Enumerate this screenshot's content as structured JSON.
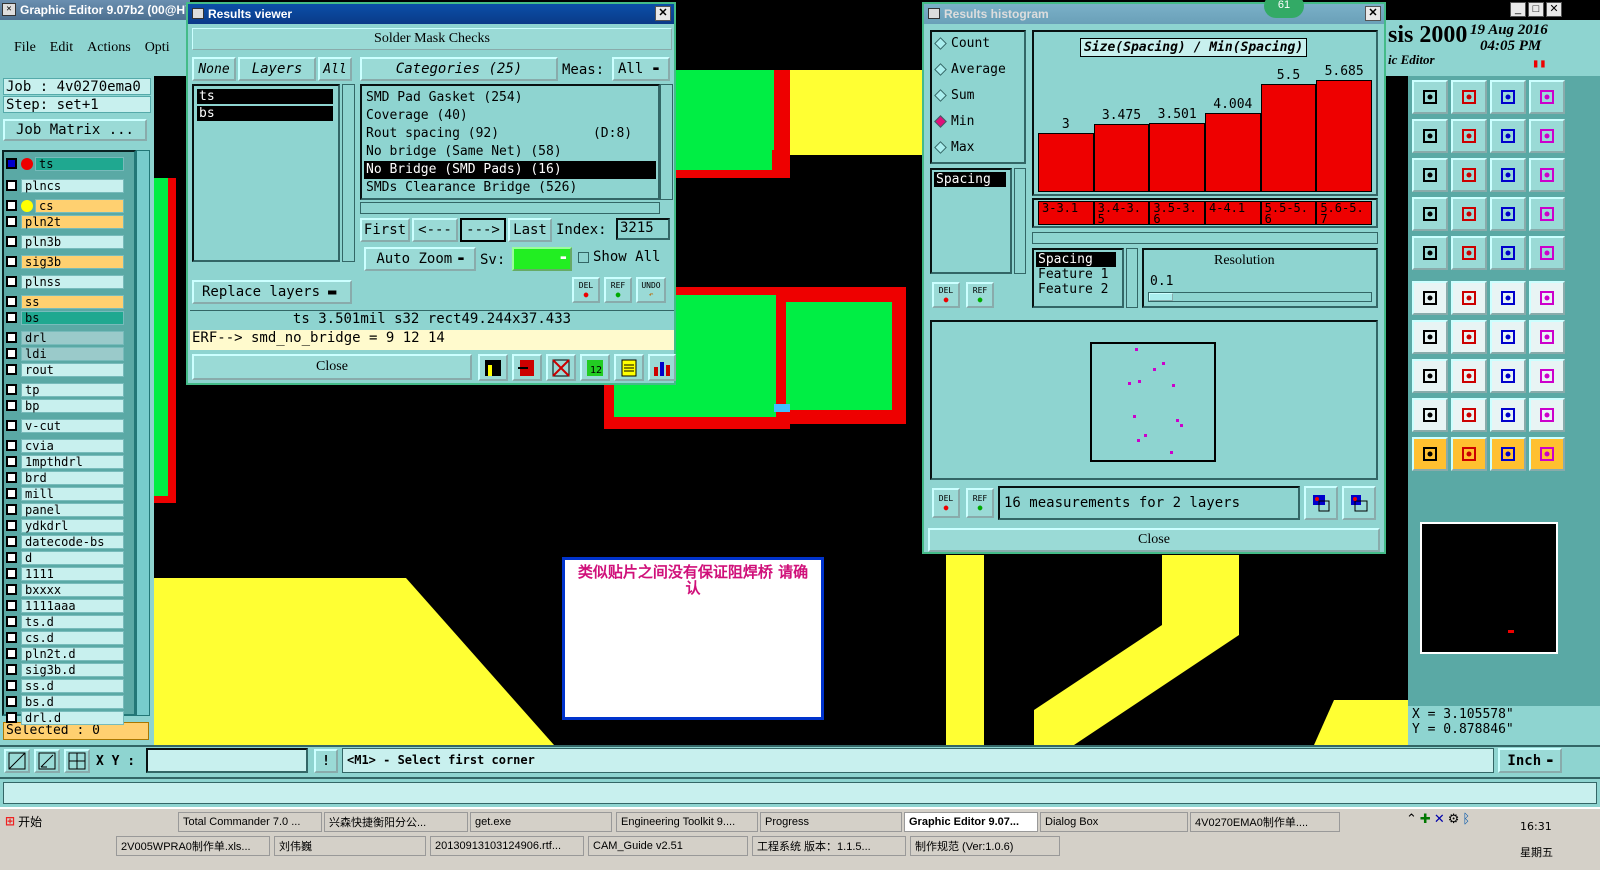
{
  "main_window": {
    "title": "Graphic Editor 9.07b2 (00@HY",
    "menu": [
      "File",
      "Edit",
      "Actions",
      "Opti"
    ],
    "job": "Job : 4v0270ema0",
    "step": "Step: set+1",
    "job_matrix": "Job Matrix ...",
    "selected": "Selected : 0",
    "xy_label": "X Y :",
    "xy_value": "",
    "prompt": "<M1> - Select first corner",
    "units": "Inch",
    "brand": "sis 2000",
    "brand_sub": "ic Editor",
    "date": "19 Aug 2016",
    "time": "04:05 PM",
    "coord_x": "X = 3.105578\"",
    "coord_y": "Y = 0.878846\"",
    "badge": "61"
  },
  "layers": [
    "ts",
    "plncs",
    "cs",
    "pln2t",
    "pln3b",
    "sig3b",
    "plnss",
    "ss",
    "bs",
    "drl",
    "ldi",
    "rout",
    "tp",
    "bp",
    "v-cut",
    "cvia",
    "1mpthdrl",
    "brd",
    "mill",
    "panel",
    "ydkdrl",
    "datecode-bs",
    "d",
    "1111",
    "bxxxx",
    "1111aaa",
    "ts.d",
    "cs.d",
    "pln2t.d",
    "sig3b.d",
    "ss.d",
    "bs.d",
    "drl.d"
  ],
  "results_viewer": {
    "title": "Results viewer",
    "header": "Solder Mask Checks",
    "none": "None",
    "layers": "Layers",
    "all": "All",
    "layer_list": [
      "ts",
      "bs"
    ],
    "categories": "Categories (25)",
    "meas_label": "Meas:",
    "meas_value": "All",
    "category_list": [
      "SMD Pad Gasket (254)",
      "Coverage (40)",
      "Rout spacing (92)            (D:8)",
      "No bridge (Same Net) (58)",
      "No Bridge (SMD Pads) (16)",
      "SMDs Clearance Bridge (526)"
    ],
    "first": "First",
    "prev": "<---",
    "next": "--->",
    "last": "Last",
    "index_label": "Index:",
    "index_value": "3215",
    "auto_zoom": "Auto Zoom",
    "sv_label": "Sv:",
    "show_all": "Show All",
    "replace_layers": "Replace layers",
    "del": "DEL",
    "ref": "REF",
    "undo": "UNDO",
    "status": "ts 3.501mil   s32   rect49.244x37.433",
    "erf": "ERF--> smd_no_bridge = 9 12 14",
    "close": "Close"
  },
  "histogram": {
    "title": "Results histogram",
    "options": [
      "Count",
      "Average",
      "Sum",
      "Min",
      "Max"
    ],
    "selected_option": "Min",
    "chart_title": "Size(Spacing) / Min(Spacing)",
    "list_item": "Spacing",
    "features": [
      "Spacing",
      "Feature 1",
      "Feature 2"
    ],
    "resolution_label": "Resolution",
    "resolution_value": "0.1",
    "measurements": "16 measurements for 2 layers",
    "close": "Close",
    "del": "DEL",
    "ref": "REF"
  },
  "chart_data": {
    "type": "bar",
    "title": "Size(Spacing) / Min(Spacing)",
    "categories": [
      "3-3.1",
      "3.4-3.5",
      "3.5-3.6",
      "4-4.1",
      "5.5-5.6",
      "5.6-5.7"
    ],
    "values": [
      3,
      3.475,
      3.501,
      4.004,
      5.5,
      5.685
    ],
    "value_labels": [
      "3",
      "3.475",
      "3.501",
      "4.004",
      "5.5",
      "5.685"
    ],
    "ylim": [
      0,
      5.9
    ]
  },
  "note": {
    "text": "类似贴片之间没有保证阻焊桥 请确认"
  },
  "taskbar": {
    "start": "开始",
    "row1": [
      "Total Commander 7.0 ...",
      "兴森快捷衡阳分公...",
      "get.exe",
      "Engineering Toolkit 9....",
      "Progress",
      "Graphic Editor 9.07...",
      "Dialog Box",
      "4V0270EMA0制作单...."
    ],
    "row2": [
      "2V005WPRA0制作单.xls...",
      "刘伟巍",
      "20130913103124906.rtf...",
      "CAM_Guide v2.51",
      "工程系统  版本：1.1.5...",
      "制作规范 (Ver:1.0.6)"
    ],
    "clock": "16:31",
    "weekday": "星期五"
  },
  "colors": {
    "teal": "#8ed4d0",
    "green_pad": "#00ee44",
    "red_mask": "#ee0000",
    "yellow_trace": "#ffff33"
  }
}
